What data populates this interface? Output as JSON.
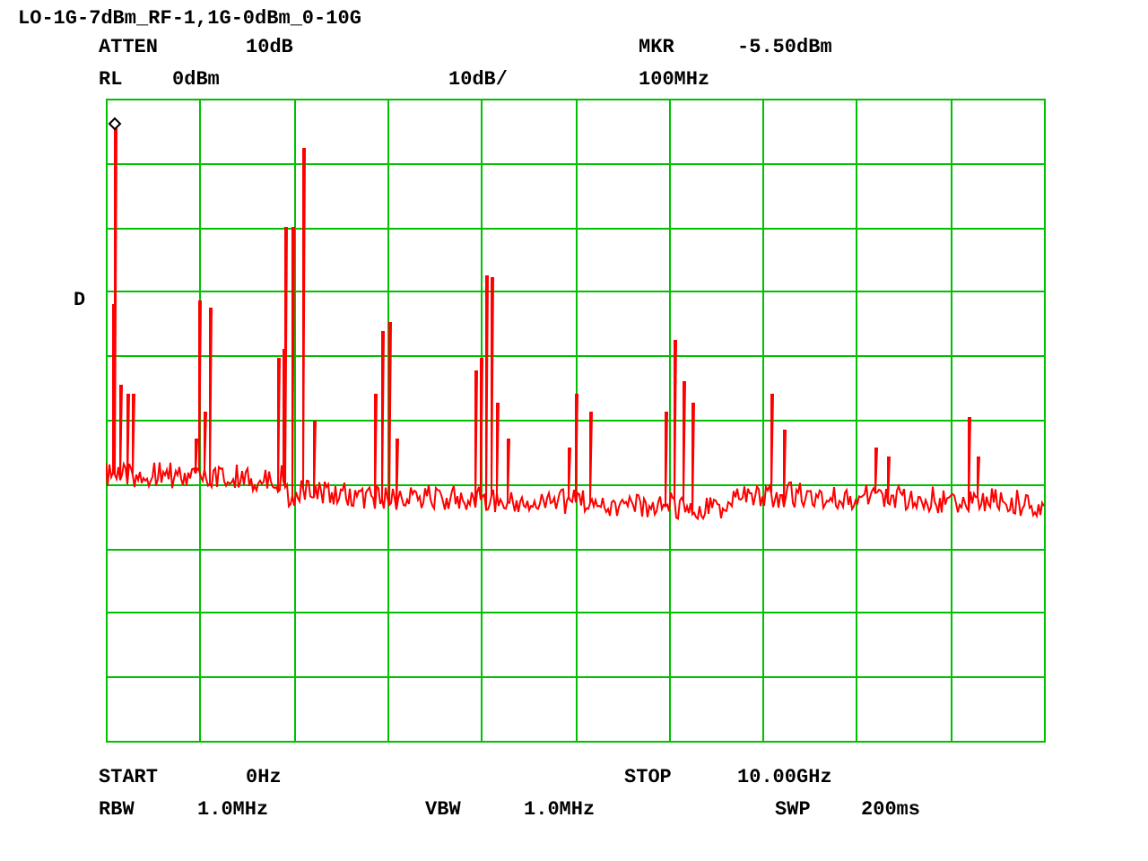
{
  "title": "LO-1G-7dBm_RF-1,1G-0dBm_0-10G",
  "top_rows": [
    [
      "ATTEN",
      "10dB",
      "MKR",
      "-5.50dBm"
    ],
    [
      "RL",
      "0dBm",
      "10dB/",
      "100MHz"
    ]
  ],
  "detector": "D",
  "bottom_rows": [
    [
      "START",
      "0Hz",
      "STOP",
      "10.00GHz"
    ],
    [
      "RBW",
      "1.0MHz",
      "VBW",
      "1.0MHz",
      "SWP",
      "200ms"
    ]
  ]
}
